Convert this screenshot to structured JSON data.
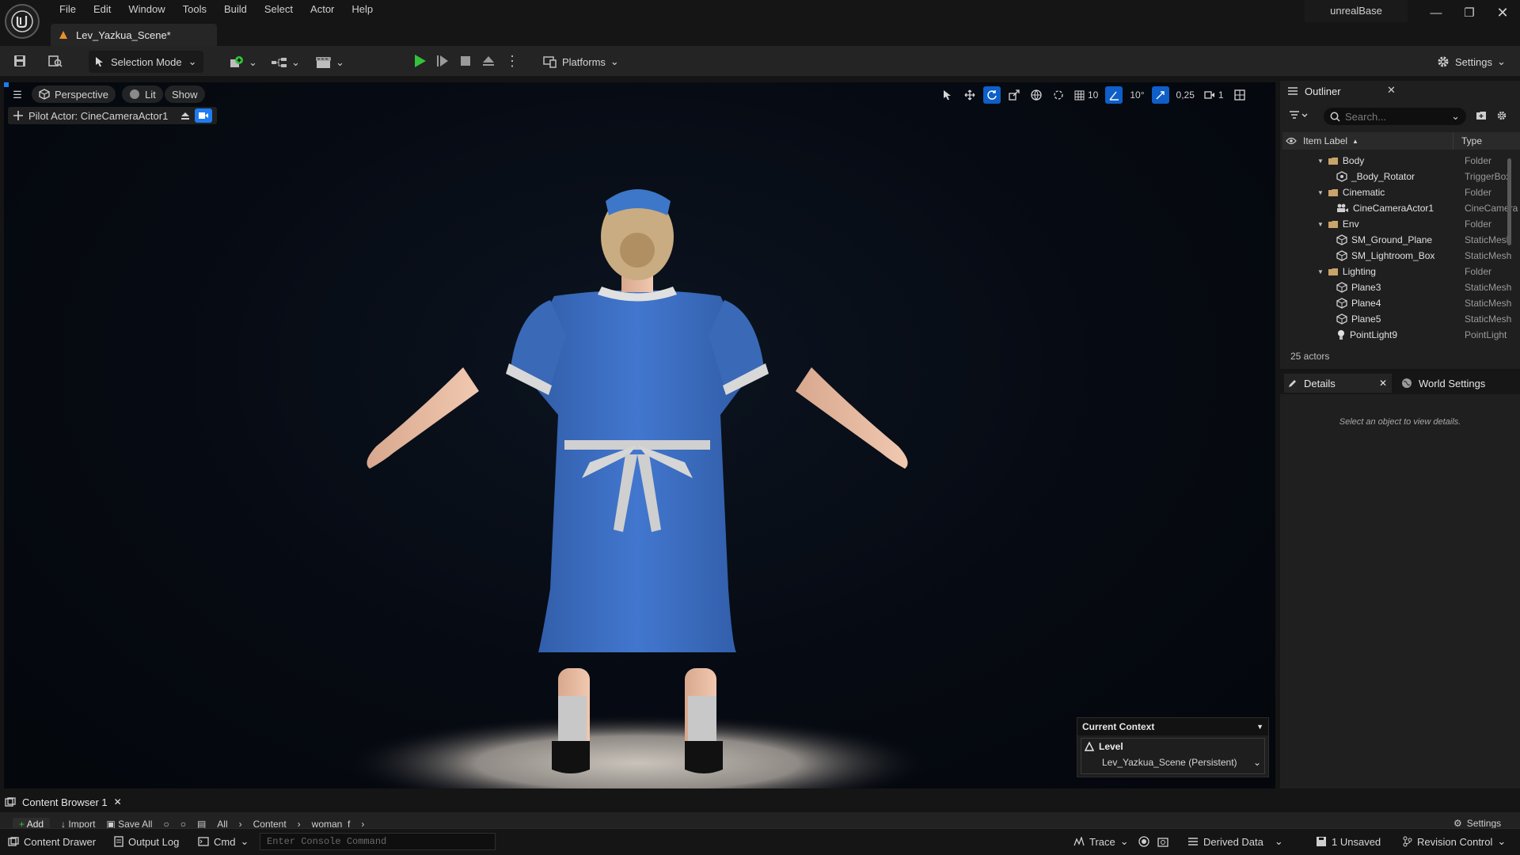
{
  "menu": [
    "File",
    "Edit",
    "Window",
    "Tools",
    "Build",
    "Select",
    "Actor",
    "Help"
  ],
  "project_name": "unrealBase",
  "level_tab": "Lev_Yazkua_Scene*",
  "toolbar": {
    "selection_mode": "Selection Mode",
    "platforms": "Platforms",
    "settings": "Settings"
  },
  "viewport": {
    "perspective": "Perspective",
    "lit": "Lit",
    "show": "Show",
    "pilot_actor": "Pilot Actor: CineCameraActor1",
    "grid_snap": "10",
    "rotation_snap": "10°",
    "scale_snap": "0,25",
    "camera_speed": "1"
  },
  "current_context": {
    "title": "Current Context",
    "level_label": "Level",
    "level_value": "Lev_Yazkua_Scene (Persistent)"
  },
  "outliner": {
    "tab": "Outliner",
    "search_placeholder": "Search...",
    "col_label": "Item Label",
    "col_type": "Type",
    "rows": [
      {
        "label": "Body",
        "type": "Folder"
      },
      {
        "label": "_Body_Rotator",
        "type": "TriggerBox"
      },
      {
        "label": "Cinematic",
        "type": "Folder"
      },
      {
        "label": "CineCameraActor1",
        "type": "CineCamera"
      },
      {
        "label": "Env",
        "type": "Folder"
      },
      {
        "label": "SM_Ground_Plane",
        "type": "StaticMesh"
      },
      {
        "label": "SM_Lightroom_Box",
        "type": "StaticMesh"
      },
      {
        "label": "Lighting",
        "type": "Folder"
      },
      {
        "label": "Plane3",
        "type": "StaticMesh"
      },
      {
        "label": "Plane4",
        "type": "StaticMesh"
      },
      {
        "label": "Plane5",
        "type": "StaticMesh"
      },
      {
        "label": "PointLight9",
        "type": "PointLight"
      }
    ],
    "actor_count": "25 actors"
  },
  "details": {
    "tab": "Details",
    "world_settings_tab": "World Settings",
    "empty_message": "Select an object to view details."
  },
  "content_browser": {
    "tab": "Content Browser 1",
    "add": "Add",
    "import": "Import",
    "save_all": "Save All",
    "path": [
      "All",
      "Content",
      "woman_f"
    ],
    "settings": "Settings"
  },
  "statusbar": {
    "content_drawer": "Content Drawer",
    "output_log": "Output Log",
    "cmd": "Cmd",
    "console_placeholder": "Enter Console Command",
    "trace": "Trace",
    "derived_data": "Derived Data",
    "unsaved": "1 Unsaved",
    "revision_control": "Revision Control"
  },
  "colors": {
    "accent": "#1e7cf0",
    "play_green": "#34c23a",
    "folder": "#c9a36a",
    "dress_blue": "#3d6fc2",
    "panel_bg": "#1f1f1f"
  }
}
